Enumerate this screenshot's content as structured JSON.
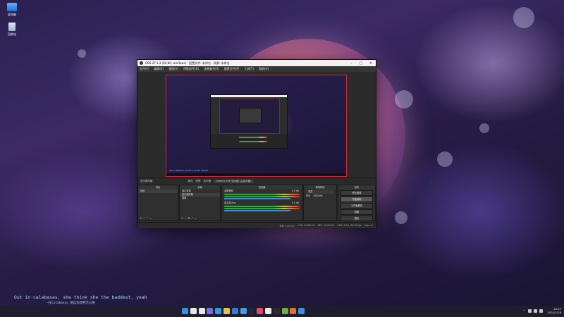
{
  "desktop": {
    "icons": [
      {
        "label": "此电脑",
        "icon": "computer-icon"
      },
      {
        "label": "回收站",
        "icon": "recycle-bin-icon"
      }
    ]
  },
  "obs": {
    "title": "OBS 27.1.3 (64-bit, windows) - 配置文件: 未命名 - 场景: 未命名",
    "menu": [
      "文件(F)",
      "编辑(E)",
      "视图(V)",
      "停靠部件(D)",
      "场景集合(S)",
      "配置文件(P)",
      "工具(T)",
      "帮助(H)"
    ],
    "preview_caption": "Out in calabasas, she think she the baddest",
    "scene_bar": {
      "source_label": "显示器采集",
      "props": "属性",
      "filters": "滤镜",
      "display": "显示器",
      "display_value": "Generic PnP 显示器 (主显示器)"
    },
    "docks": {
      "scenes": {
        "title": "场景",
        "items": [
          "场景"
        ]
      },
      "sources": {
        "title": "来源",
        "items": [
          "窗口采集",
          "显示器采集",
          "图像"
        ]
      },
      "mixer": {
        "title": "混音器",
        "channels": [
          {
            "name": "桌面音频",
            "db": "0.0 dB"
          },
          {
            "name": "麦克风/Aux",
            "db": "0.0 dB"
          }
        ]
      },
      "transitions": {
        "title": "转场特效",
        "type": "渐变",
        "duration_label": "时长",
        "duration": "300 ms"
      },
      "controls": {
        "title": "控件",
        "buttons": [
          "停止推流",
          "开始录制",
          "工作室模式",
          "设置",
          "退出"
        ]
      }
    },
    "status": {
      "dropped": "丢帧 0 (0.0%)",
      "live": "LIVE: 00:00:00",
      "rec": "REC: 00:00:00",
      "cpu": "CPU: 1.5%, 30.00 fps",
      "kbps": "kb/s: 0"
    }
  },
  "lyrics": {
    "line1": "Out in calabasas, she think she the baddest, yeah",
    "line2": "—在Calabasas 她自信得熟无火略"
  },
  "taskbar": {
    "clock_time": "18:57",
    "clock_date": "2022/1/18",
    "app_icons": [
      "start-icon",
      "search-icon",
      "task-view-icon",
      "chat-icon",
      "edge-icon",
      "explorer-icon",
      "store-icon",
      "mail-icon",
      "steam-icon",
      "app-icon",
      "app-icon",
      "obs-icon",
      "app-icon",
      "app-icon",
      "app-icon"
    ],
    "app_colors": [
      "#3a8fe0",
      "#e8e8e8",
      "#e8e8e8",
      "#7b6be0",
      "#2d9be0",
      "#e8c050",
      "#3a7ad6",
      "#4a9ae0",
      "#1b2838",
      "#e04a6a",
      "#e8e8e8",
      "#2b2b2b",
      "#6ab04a",
      "#e07030",
      "#3a8fe0"
    ]
  },
  "colors": {
    "preview_border": "#c62b3b",
    "lyric_text": "#9fd6ff"
  }
}
